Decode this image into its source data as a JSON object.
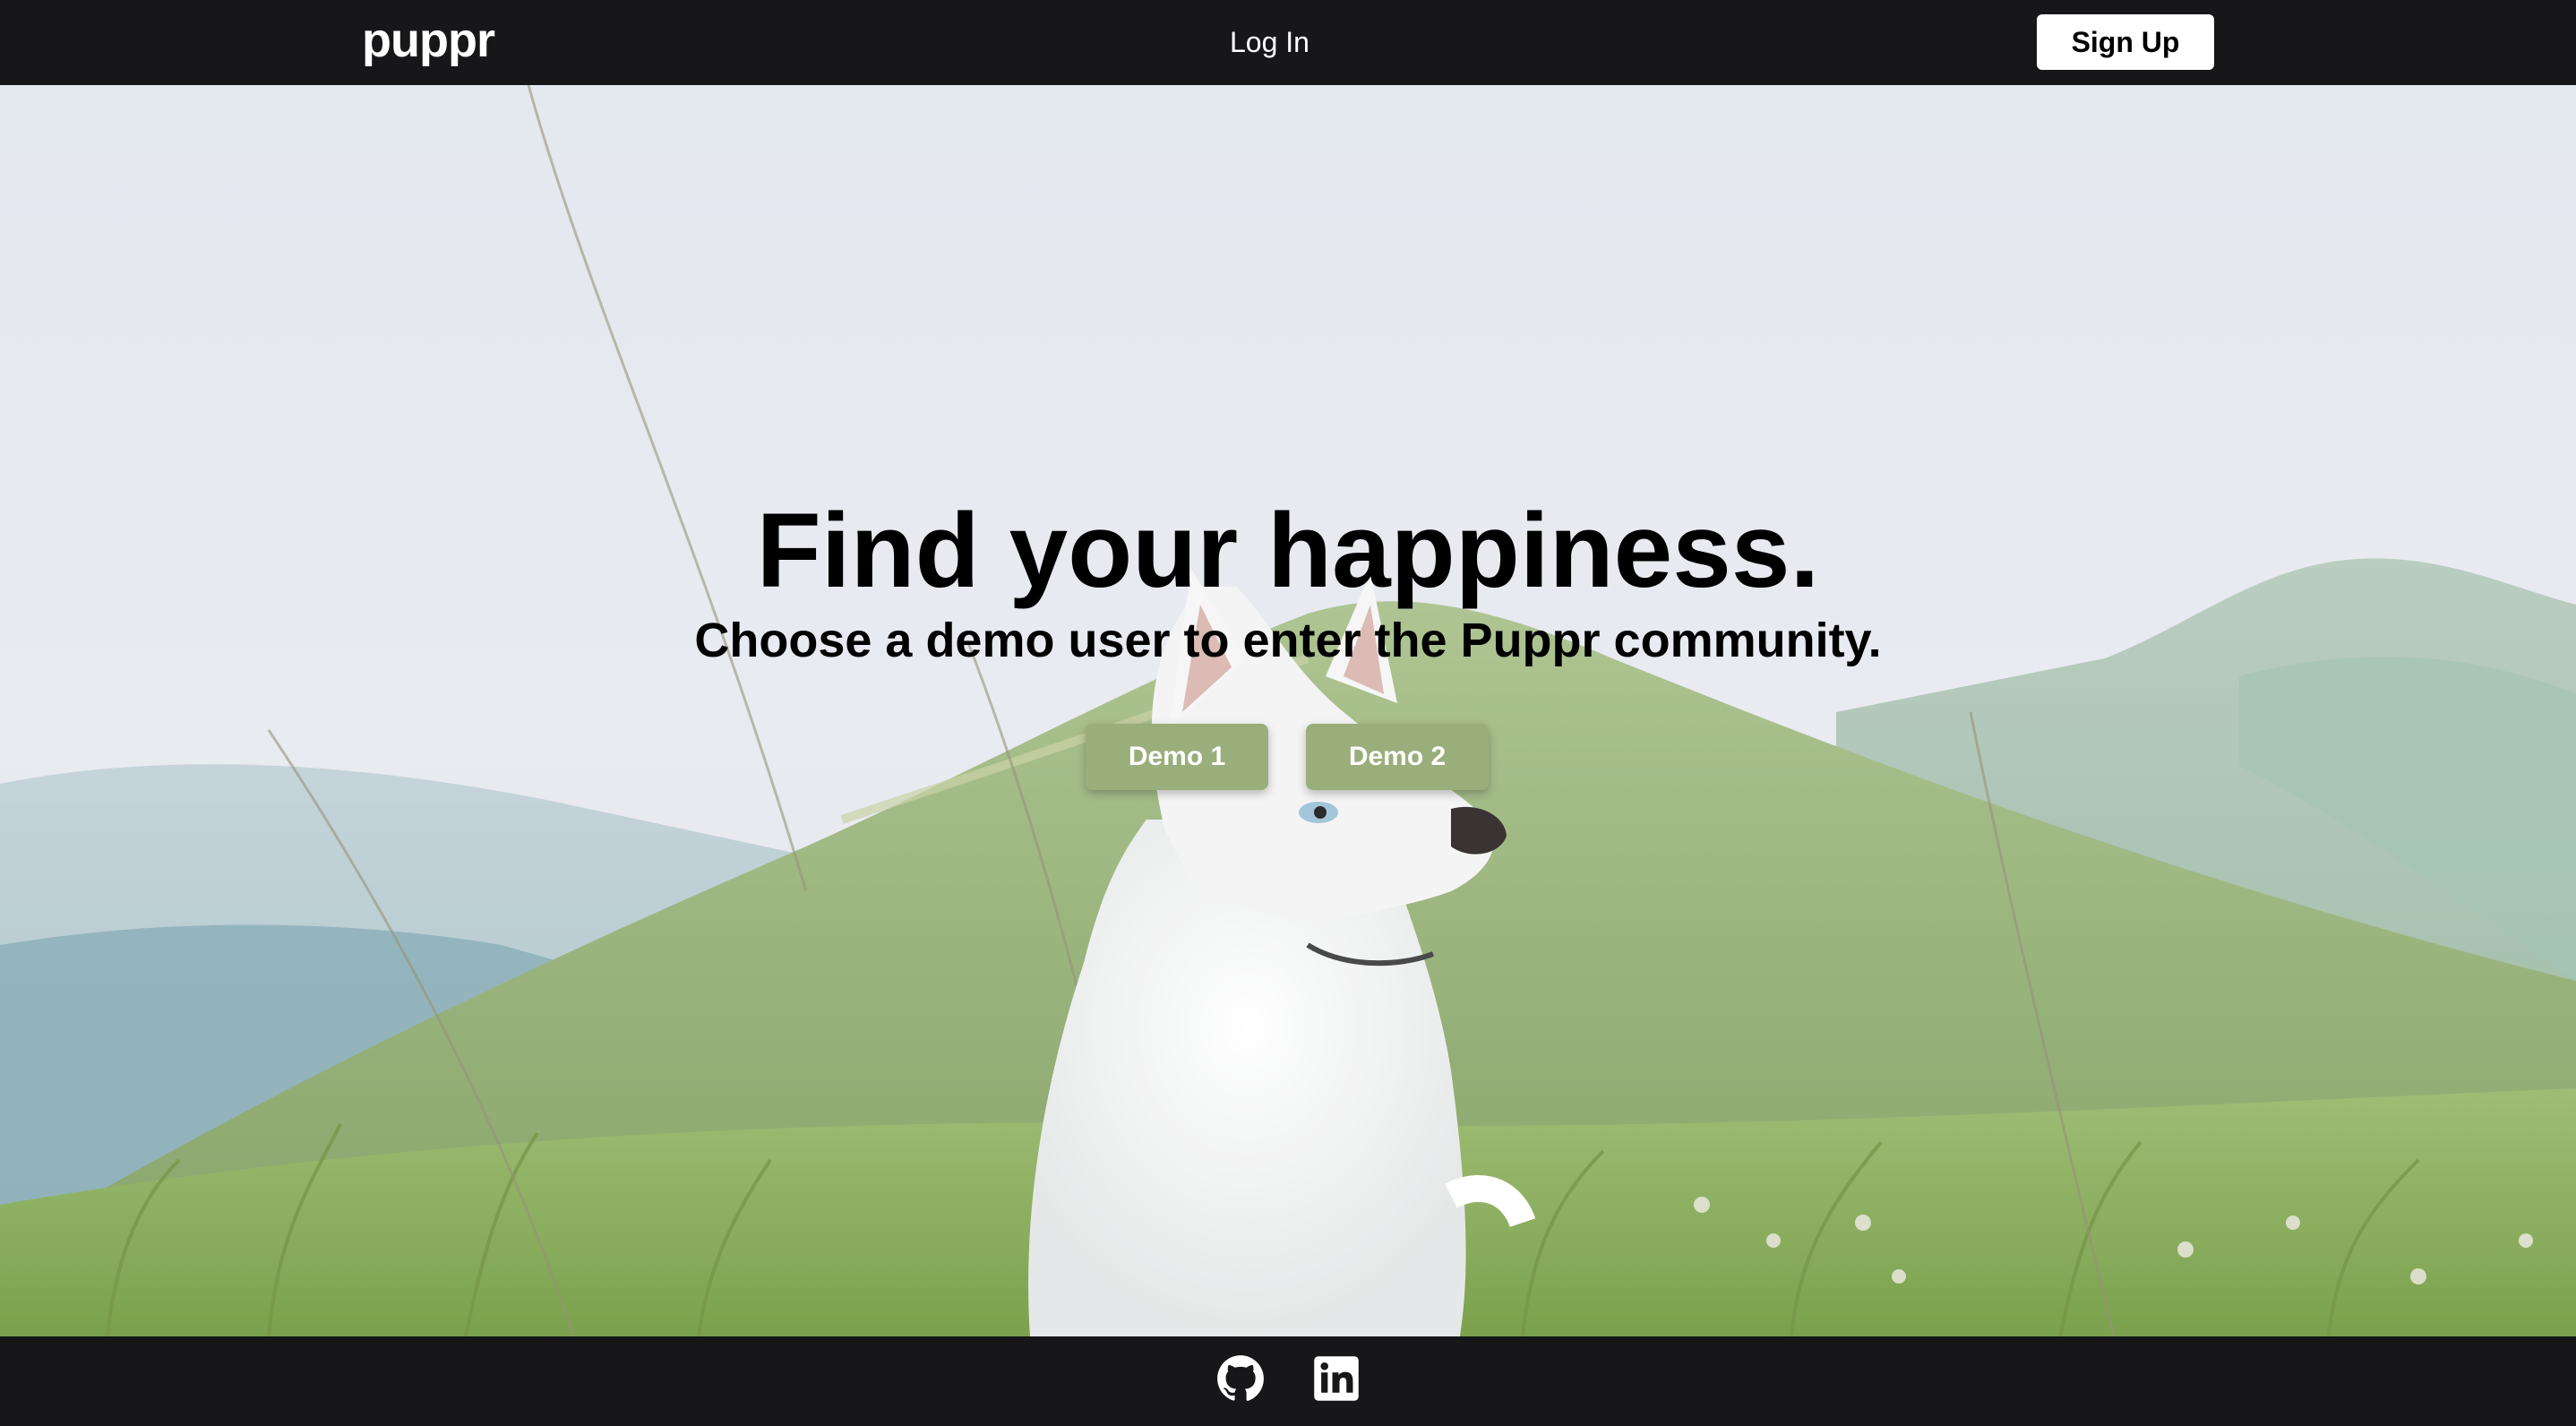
{
  "navbar": {
    "logo": "puppr",
    "login_label": "Log In",
    "signup_label": "Sign Up"
  },
  "hero": {
    "title": "Find your happiness.",
    "subtitle": "Choose a demo user to enter the Puppr community.",
    "demo1_label": "Demo 1",
    "demo2_label": "Demo 2",
    "background_image": "white-husky-in-mountain-meadow"
  },
  "footer": {
    "icons": [
      "github-icon",
      "linkedin-icon"
    ]
  },
  "colors": {
    "bar_background": "#17171a",
    "demo_button": "#9aae7c",
    "signup_button": "#ffffff"
  }
}
